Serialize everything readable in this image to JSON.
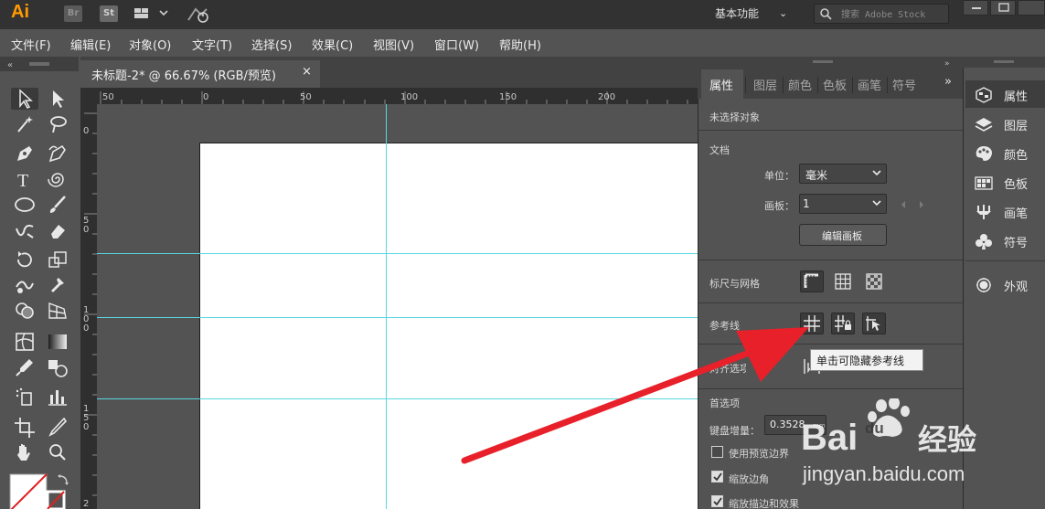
{
  "app": {
    "logo": "Ai",
    "bridge_label": "Br",
    "stock_label": "St",
    "workspace": "基本功能",
    "search_placeholder": "搜索 Adobe Stock"
  },
  "menu": [
    "文件(F)",
    "编辑(E)",
    "对象(O)",
    "文字(T)",
    "选择(S)",
    "效果(C)",
    "视图(V)",
    "窗口(W)",
    "帮助(H)"
  ],
  "document": {
    "tab_title": "未标题-2* @ 66.67% (RGB/预览)",
    "close": "×"
  },
  "rulers": {
    "top": [
      "50",
      "0",
      "50",
      "100",
      "150",
      "200"
    ],
    "left": [
      "0",
      "5",
      "0",
      "1",
      "0",
      "0",
      "1",
      "5",
      "0",
      "2"
    ]
  },
  "properties": {
    "tabs": [
      "属性",
      "图层",
      "颜色",
      "色板",
      "画笔",
      "符号"
    ],
    "expand": "»",
    "no_selection": "未选择对象",
    "doc_section": "文档",
    "unit_label": "单位：",
    "unit_value": "毫米",
    "artboard_label": "画板：",
    "artboard_value": "1",
    "edit_artboards": "编辑画板",
    "rulers_grids": "标尺与网格",
    "guides": "参考线",
    "snap_fragment": "对齐选项",
    "prefs_section": "首选项",
    "keyboard_increment_label": "键盘增量：",
    "keyboard_increment_value": "0.3528",
    "keyboard_increment_unit": "mm",
    "preview_bounds": "使用预览边界",
    "scale_corners": "缩放边角",
    "scale_strokes": "缩放描边和效果"
  },
  "tooltip": "单击可隐藏参考线",
  "dock": [
    {
      "label": "属性",
      "icon": "properties-icon"
    },
    {
      "label": "图层",
      "icon": "layers-icon"
    },
    {
      "label": "颜色",
      "icon": "color-icon"
    },
    {
      "label": "色板",
      "icon": "swatches-icon"
    },
    {
      "label": "画笔",
      "icon": "brushes-icon"
    },
    {
      "label": "符号",
      "icon": "symbols-icon"
    },
    {
      "label": "外观",
      "icon": "appearance-icon"
    }
  ],
  "watermark": {
    "brand_left": "Bai",
    "brand_right": "经验",
    "url": "jingyan.baidu.com"
  },
  "colors": {
    "guide": "#5ad6e0",
    "arrow": "#e8202a",
    "logo": "#ff9a00"
  }
}
